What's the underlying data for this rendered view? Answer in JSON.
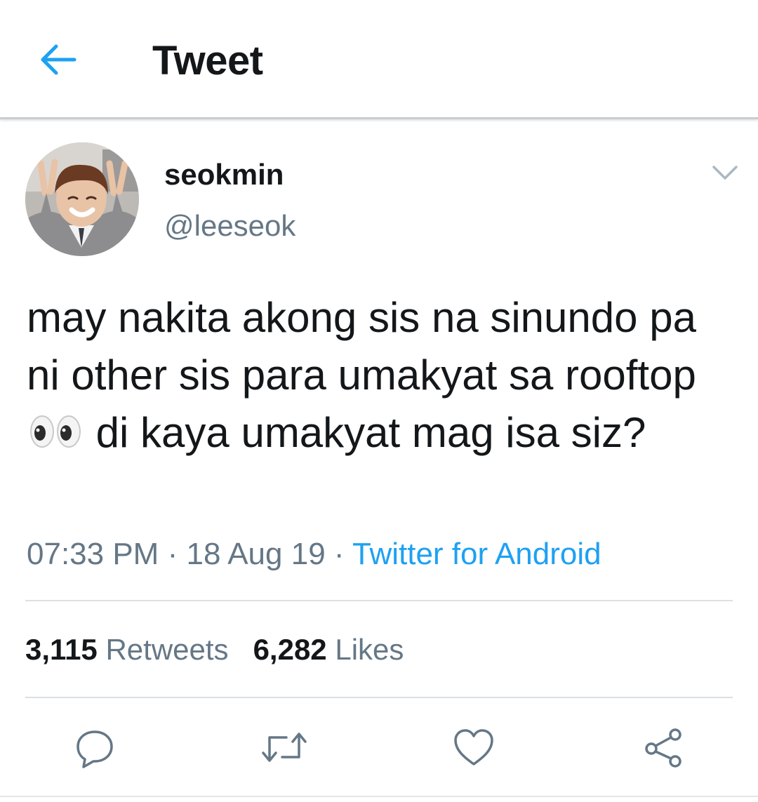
{
  "header": {
    "back_icon": "arrow-left-icon",
    "title": "Tweet"
  },
  "tweet": {
    "avatar": "profile-photo",
    "display_name": "seokmin",
    "handle": "@leeseok",
    "menu_icon": "chevron-down-icon",
    "text_part1": "may nakita akong sis na sinundo pa ni other sis para umakyat sa rooftop",
    "emoji": "eyes-emoji",
    "text_part2": "di kaya umakyat mag isa siz?",
    "time": "07:33 PM",
    "date": "18 Aug 19",
    "separator": "·",
    "source": "Twitter for Android"
  },
  "stats": {
    "retweets_count": "3,115",
    "retweets_label": "Retweets",
    "likes_count": "6,282",
    "likes_label": "Likes"
  },
  "actions": {
    "reply_icon": "reply-icon",
    "retweet_icon": "retweet-icon",
    "like_icon": "heart-icon",
    "share_icon": "share-icon"
  },
  "colors": {
    "accent": "#1da1f2",
    "text": "#14171a",
    "secondary": "#657786",
    "divider": "#dbe0e4"
  }
}
